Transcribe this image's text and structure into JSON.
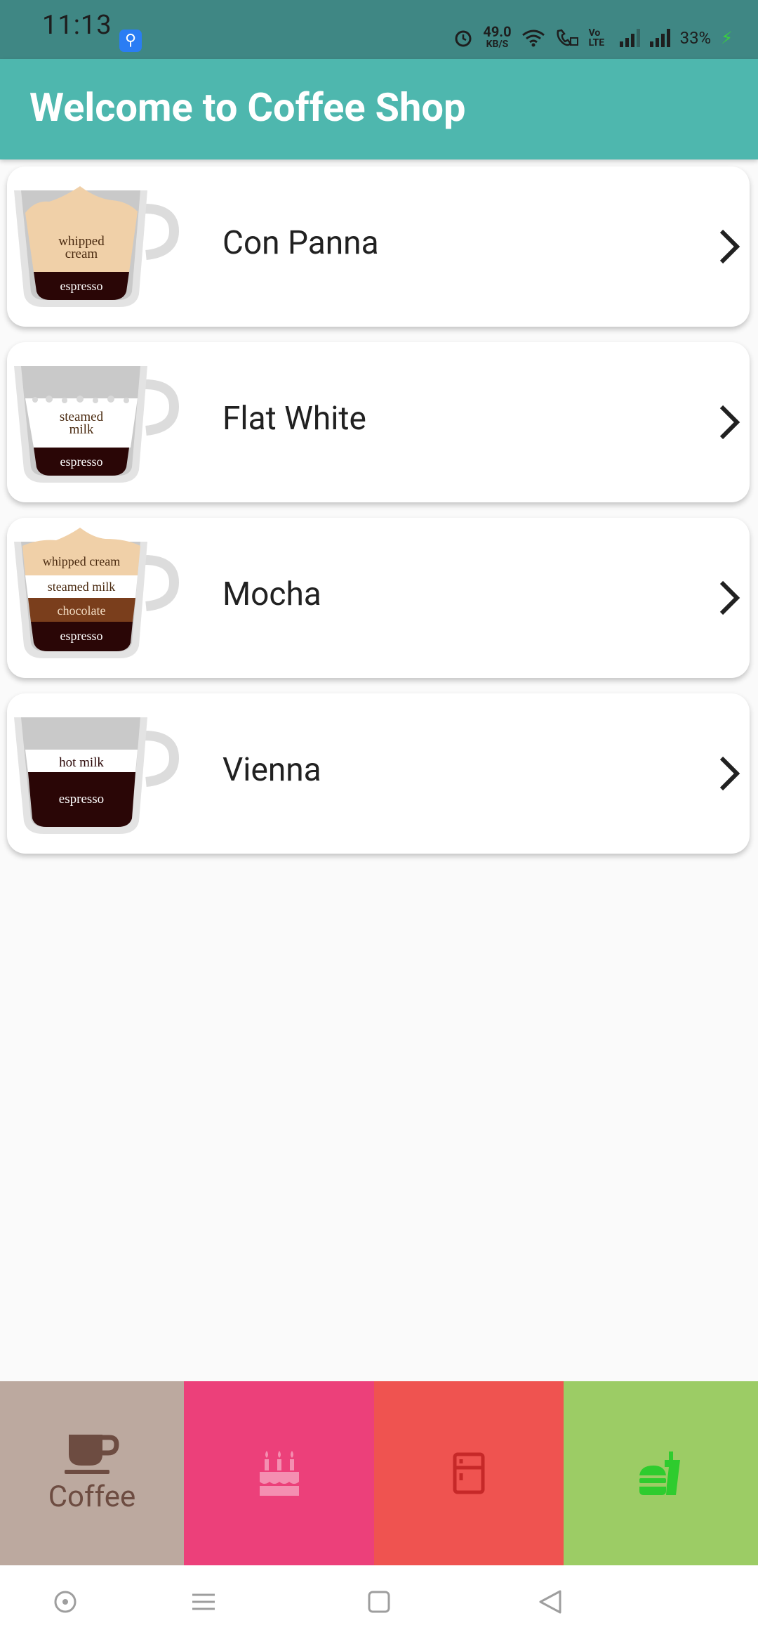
{
  "status_bar": {
    "time": "11:13",
    "net_speed_value": "49.0",
    "net_speed_unit": "KB/S",
    "volte": "Vo LTE",
    "battery": "33%"
  },
  "app_bar": {
    "title": "Welcome to Coffee Shop"
  },
  "coffees": [
    {
      "name": "Con Panna",
      "layers": [
        "whipped",
        "cream",
        "espresso"
      ]
    },
    {
      "name": "Flat White",
      "layers": [
        "steamed",
        "milk",
        "espresso"
      ]
    },
    {
      "name": "Mocha",
      "layers": [
        "whipped cream",
        "steamed milk",
        "chocolate",
        "espresso"
      ]
    },
    {
      "name": "Vienna",
      "layers": [
        "hot milk",
        "espresso"
      ]
    }
  ],
  "bottom_nav": {
    "coffee_label": "Coffee",
    "items": [
      "coffee-icon",
      "cake-icon",
      "fridge-icon",
      "fastfood-icon"
    ],
    "colors": {
      "coffee": "#bca99f",
      "cake": "#ec407a",
      "fridge": "#ef5350",
      "food": "#9ccc65"
    }
  },
  "accent": "#4eb7ae"
}
